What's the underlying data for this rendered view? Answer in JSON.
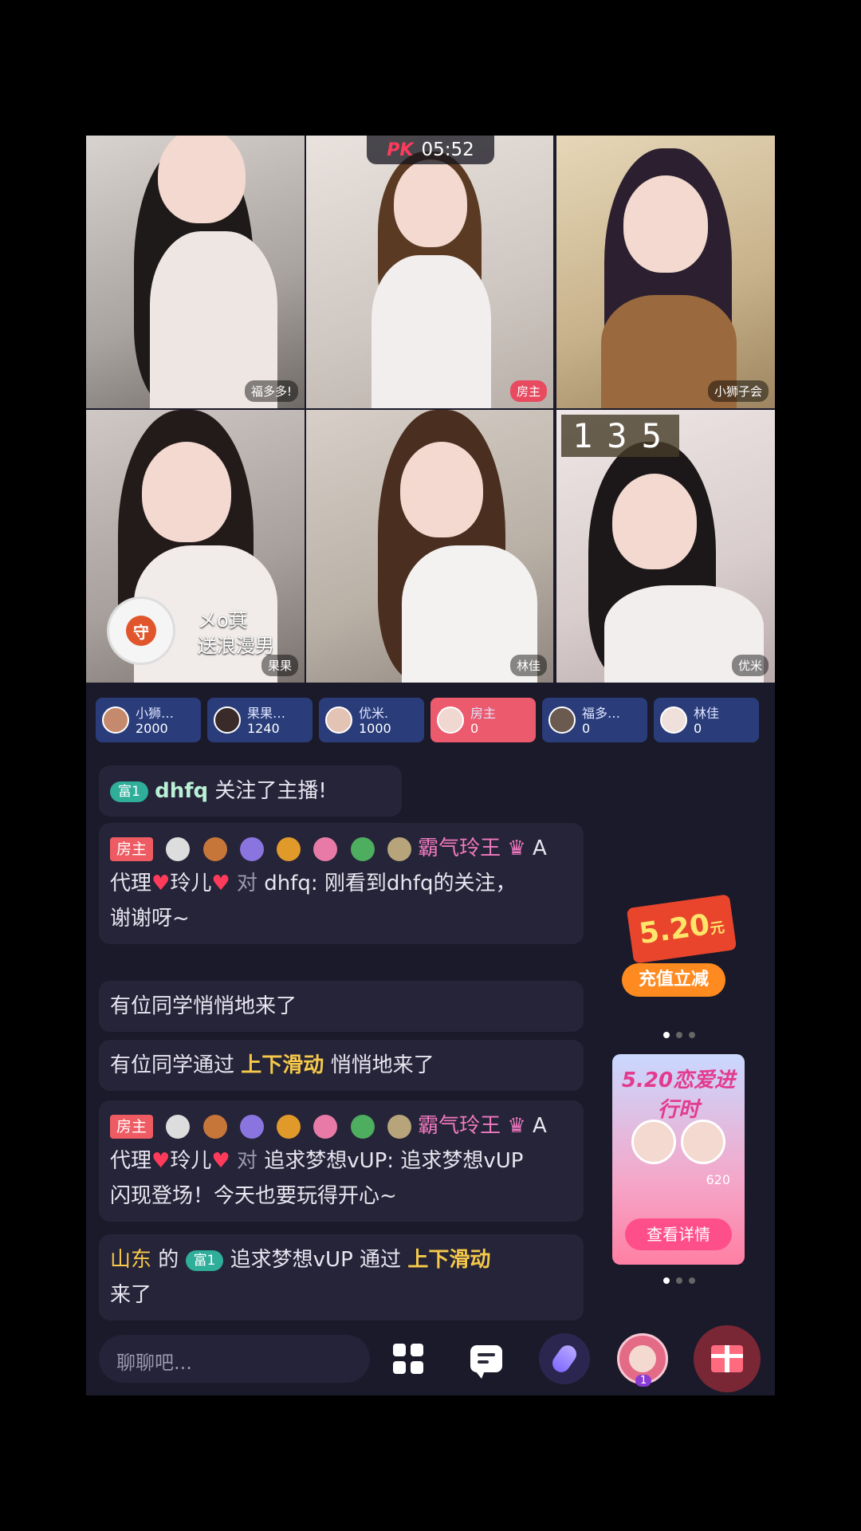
{
  "pk": {
    "logo": "PK",
    "timer": "05:52"
  },
  "streams": [
    {
      "name": "福多多!",
      "tag_style": "plain"
    },
    {
      "name": "房主",
      "tag_style": "host"
    },
    {
      "name": "小狮子会",
      "tag_style": "plain"
    },
    {
      "name": "果果",
      "tag_style": "plain",
      "gift_text_1": "メo萁",
      "gift_text_2": "送浪漫男"
    },
    {
      "name": "林佳",
      "tag_style": "plain"
    },
    {
      "name": "优米",
      "tag_style": "plain",
      "score": "135"
    }
  ],
  "ranking": [
    {
      "name": "小狮…",
      "score": "2000"
    },
    {
      "name": "果果…",
      "score": "1240"
    },
    {
      "name": "优米.",
      "score": "1000"
    },
    {
      "name": "房主",
      "score": "0",
      "is_host": true
    },
    {
      "name": "福多…",
      "score": "0"
    },
    {
      "name": "林佳",
      "score": "0"
    }
  ],
  "chat": {
    "m1": {
      "badge": "富1",
      "user": "dhfq",
      "text": "关注了主播!"
    },
    "m2": {
      "badge": "房主",
      "user": "霸气玲王",
      "level": "A",
      "line2_prefix": "代理",
      "line2_name": "玲儿",
      "to_word": "对",
      "to_user": "dhfq:",
      "text": "刚看到dhfq的关注，",
      "text2": "谢谢呀~"
    },
    "m3": {
      "text": "有位同学悄悄地来了"
    },
    "m4": {
      "text1": "有位同学通过",
      "hl": "上下滑动",
      "text2": "悄悄地来了"
    },
    "m5": {
      "badge": "房主",
      "user": "霸气玲王",
      "level": "A",
      "line2_prefix": "代理",
      "line2_name": "玲儿",
      "to_word": "对",
      "to_user": "追求梦想vUP:",
      "text": "追求梦想vUP",
      "text2": "闪现登场！今天也要玩得开心~"
    },
    "m6": {
      "region": "山东",
      "of": "的",
      "badge": "富1",
      "user": "追求梦想vUP",
      "via": "通过",
      "hl": "上下滑动",
      "end": "来了"
    }
  },
  "promo": {
    "coupon_value": "5.20",
    "coupon_unit": "元",
    "recharge_label": "充值立减",
    "event_title": "5.20恋爱进行时",
    "event_score": "620",
    "detail_label": "查看详情",
    "avatar_badge": "1"
  },
  "input": {
    "placeholder": "聊聊吧..."
  }
}
